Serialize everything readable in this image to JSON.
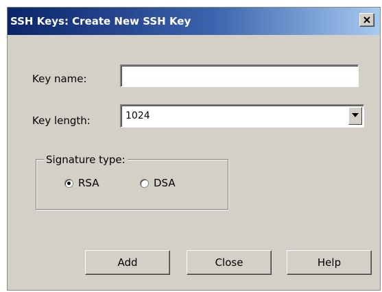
{
  "window": {
    "title": "SSH Keys: Create New SSH Key",
    "close_glyph": "✕"
  },
  "form": {
    "key_name_label": "Key name:",
    "key_name_value": "",
    "key_length_label": "Key length:",
    "key_length_value": "1024",
    "signature_type_label": "Signature type:",
    "signature_options": [
      {
        "label": "RSA",
        "selected": true
      },
      {
        "label": "DSA",
        "selected": false
      }
    ]
  },
  "buttons": {
    "add_label": "Add",
    "close_label": "Close",
    "help_label": "Help"
  },
  "colors": {
    "dialog_face": "#d4d0c8",
    "titlebar_start": "#0a246a",
    "titlebar_end": "#a6caf0"
  },
  "icons": {
    "close": "close-icon",
    "dropdown": "chevron-down-icon"
  }
}
